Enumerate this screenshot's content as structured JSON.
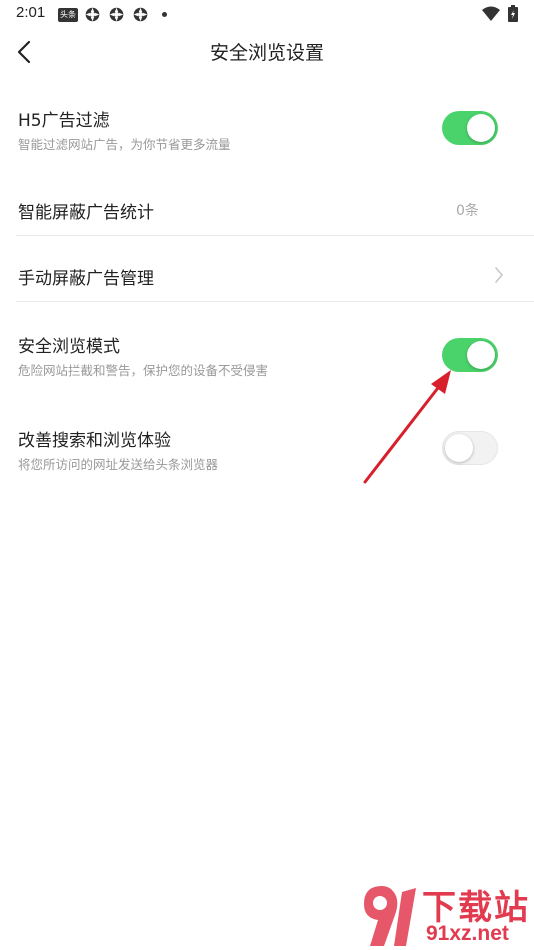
{
  "status_bar": {
    "time": "2:01",
    "news_icon_text": "头条",
    "icons": [
      "news-app-icon",
      "gear-icon",
      "gear-icon",
      "gear-icon",
      "dot",
      "wifi-icon",
      "battery-icon"
    ]
  },
  "header": {
    "title": "安全浏览设置",
    "back_icon": "back-arrow-icon"
  },
  "settings": [
    {
      "title": "H5广告过滤",
      "subtitle": "智能过滤网站广告，为你节省更多流量",
      "control": "toggle",
      "enabled": true
    },
    {
      "title": "智能屏蔽广告统计",
      "value": "0条",
      "control": "value"
    },
    {
      "title": "手动屏蔽广告管理",
      "control": "chevron"
    },
    {
      "title": "安全浏览模式",
      "subtitle": "危险网站拦截和警告，保护您的设备不受侵害",
      "control": "toggle",
      "enabled": true
    },
    {
      "title": "改善搜索和浏览体验",
      "subtitle": "将您所访问的网址发送给头条浏览器",
      "control": "toggle",
      "enabled": false
    }
  ],
  "annotation": {
    "type": "red-arrow",
    "points_to": "安全浏览模式 toggle"
  },
  "watermark": {
    "top": "下载站",
    "bottom": "91xz.net",
    "logo": "91-logo"
  },
  "colors": {
    "toggle_on": "#4bd36b",
    "toggle_off": "#f2f2f2",
    "arrow": "#d8202c",
    "watermark": "#e23a4f"
  }
}
